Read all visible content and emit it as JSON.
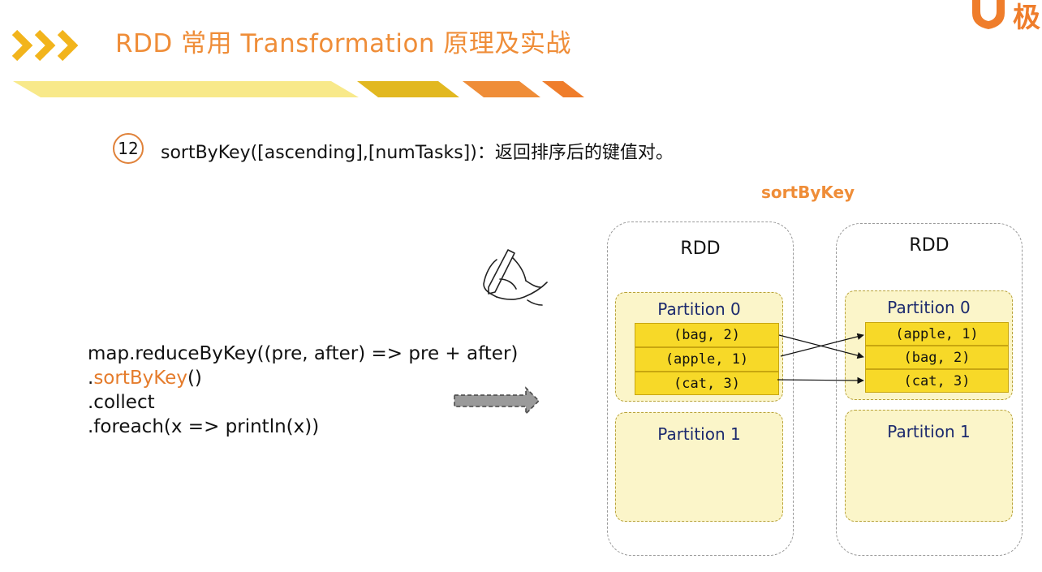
{
  "header": {
    "title": "RDD 常用 Transformation 原理及实战",
    "logo_text": "极"
  },
  "item": {
    "number": "12",
    "text": "sortByKey([ascending],[numTasks])：返回排序后的键值对。"
  },
  "code": {
    "line1": "map.reduceByKey((pre, after) => pre + after)",
    "line2_prefix": ".",
    "line2_highlight": "sortByKey",
    "line2_suffix": "()",
    "line3": ".collect",
    "line4": ".foreach(x => println(x))"
  },
  "diagram": {
    "title": "sortByKey",
    "left_rdd": {
      "label": "RDD",
      "partition0": {
        "label": "Partition 0",
        "records": [
          "(bag, 2)",
          "(apple, 1)",
          "(cat, 3)"
        ]
      },
      "partition1": {
        "label": "Partition 1"
      }
    },
    "right_rdd": {
      "label": "RDD",
      "partition0": {
        "label": "Partition 0",
        "records": [
          "(apple, 1)",
          "(bag, 2)",
          "(cat, 3)"
        ]
      },
      "partition1": {
        "label": "Partition 1"
      }
    }
  },
  "colors": {
    "accent_orange": "#ef8d38",
    "record_yellow": "#f7d928",
    "partition_bg": "#fbf5c9",
    "partition_label": "#1c2a6e"
  },
  "icons": [
    "chevron-arrows-icon",
    "logo-icon",
    "hand-writing-icon",
    "dashed-arrow-icon"
  ]
}
